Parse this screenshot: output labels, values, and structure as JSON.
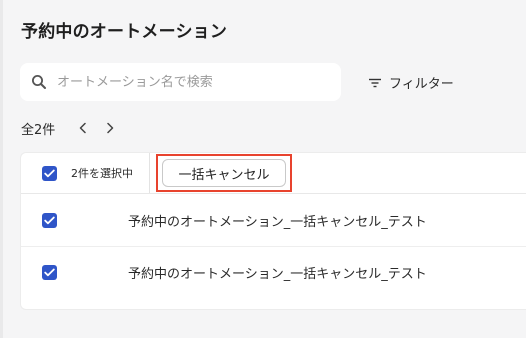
{
  "page": {
    "title": "予約中のオートメーション"
  },
  "search": {
    "placeholder": "オートメーション名で検索",
    "value": ""
  },
  "filter": {
    "label": "フィルター"
  },
  "pagination": {
    "count_label": "全2件"
  },
  "bulk": {
    "selected_text": "2件を選択中",
    "cancel_button_label": "一括キャンセル"
  },
  "rows": [
    {
      "name": "予約中のオートメーション_一括キャンセル_テスト",
      "checked": true
    },
    {
      "name": "予約中のオートメーション_一括キャンセル_テスト",
      "checked": true
    }
  ],
  "colors": {
    "checkbox": "#2f55c8",
    "highlight": "#e8432e"
  },
  "icons": {
    "search": "search-icon",
    "filter": "filter-icon",
    "prev": "chevron-left-icon",
    "next": "chevron-right-icon",
    "check": "check-icon"
  }
}
